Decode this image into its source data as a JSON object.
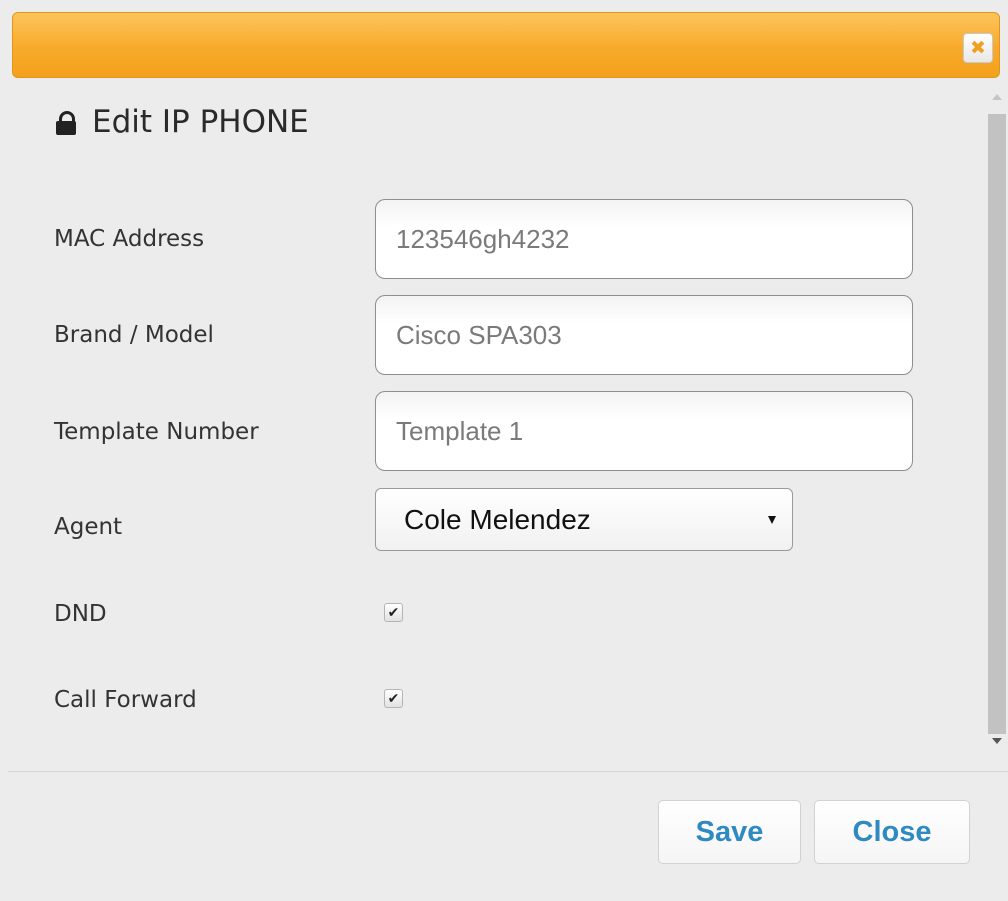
{
  "dialog": {
    "title": "Edit IP PHONE",
    "close_glyph": "✖"
  },
  "form": {
    "mac": {
      "label": "MAC Address",
      "placeholder": "123546gh4232"
    },
    "brand": {
      "label": "Brand / Model",
      "placeholder": "Cisco SPA303"
    },
    "template": {
      "label": "Template Number",
      "placeholder": "Template 1"
    },
    "agent": {
      "label": "Agent",
      "selected": "Cole Melendez"
    },
    "dnd": {
      "label": "DND",
      "checked": true
    },
    "call_forward": {
      "label": "Call Forward",
      "checked": true
    }
  },
  "footer": {
    "save_label": "Save",
    "close_label": "Close"
  },
  "colors": {
    "titlebar": "#f7aa2a",
    "button_text": "#2e8ac0",
    "close_glyph": "#f0a020"
  },
  "icons": {
    "lock": "lock-icon",
    "close": "close-icon",
    "check": "✔"
  }
}
